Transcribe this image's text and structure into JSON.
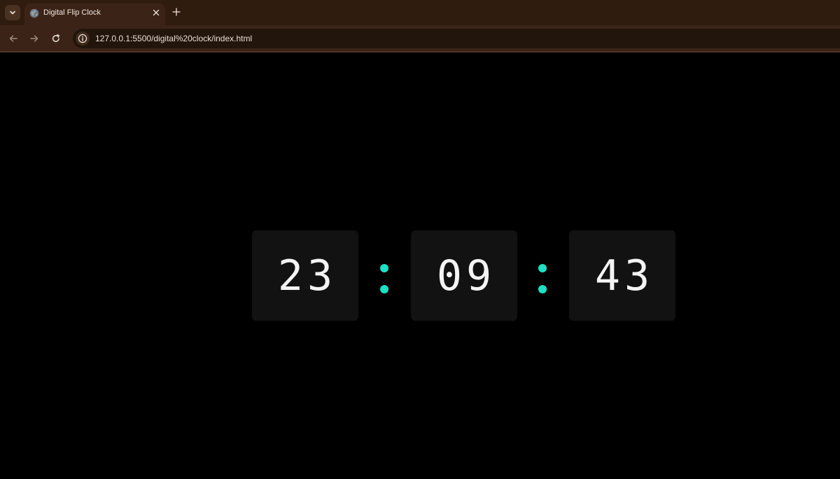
{
  "browser": {
    "tab": {
      "title": "Digital Flip Clock",
      "favicon": "globe-icon",
      "close_icon": "close-icon"
    },
    "tab_search_icon": "chevron-down-icon",
    "new_tab_icon": "plus-icon",
    "nav": {
      "back_icon": "arrow-left-icon",
      "forward_icon": "arrow-right-icon",
      "reload_icon": "reload-icon"
    },
    "address": {
      "info_icon": "info-icon",
      "url": "127.0.0.1:5500/digital%20clock/index.html"
    }
  },
  "clock": {
    "hours": "23",
    "minutes": "09",
    "seconds": "43",
    "separator_color": "#1de0c4",
    "card_color": "#121212",
    "digit_color": "#f4f4f4"
  }
}
